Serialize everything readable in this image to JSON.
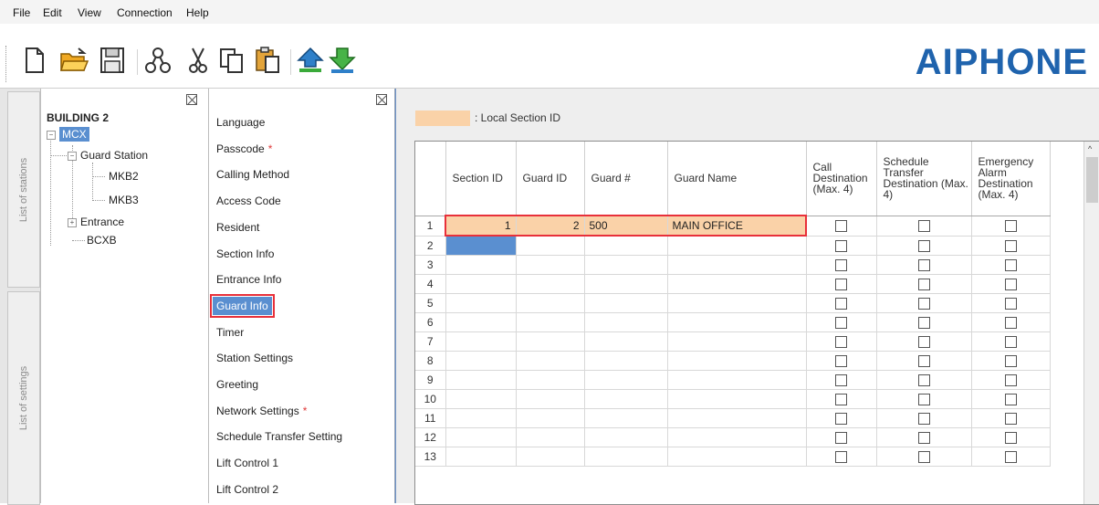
{
  "menu": [
    "File",
    "Edit",
    "View",
    "Connection",
    "Help"
  ],
  "brand": "AIPHONE",
  "side_tabs": {
    "stations": "List of stations",
    "settings": "List of settings"
  },
  "tree": {
    "root": "BUILDING 2",
    "mcx": "MCX",
    "guard_station": "Guard Station",
    "mkb2": "MKB2",
    "mkb3": "MKB3",
    "entrance": "Entrance",
    "bcxb": "BCXB"
  },
  "settings": [
    {
      "label": "Language",
      "required": false
    },
    {
      "label": "Passcode",
      "required": true
    },
    {
      "label": "Calling Method",
      "required": false
    },
    {
      "label": "Access Code",
      "required": false
    },
    {
      "label": "Resident",
      "required": false
    },
    {
      "label": "Section Info",
      "required": false
    },
    {
      "label": "Entrance Info",
      "required": false
    },
    {
      "label": "Guard Info",
      "required": false,
      "selected": true
    },
    {
      "label": "Timer",
      "required": false
    },
    {
      "label": "Station Settings",
      "required": false
    },
    {
      "label": "Greeting",
      "required": false
    },
    {
      "label": "Network Settings",
      "required": true
    },
    {
      "label": "Schedule Transfer Setting",
      "required": false
    },
    {
      "label": "Lift Control 1",
      "required": false
    },
    {
      "label": "Lift Control 2",
      "required": false
    }
  ],
  "legend": {
    "text": ": Local Section ID",
    "color": "#fad2a8"
  },
  "columns": [
    "Section ID",
    "Guard ID",
    "Guard #",
    "Guard Name",
    "Call Destination (Max. 4)",
    "Schedule Transfer Destination (Max. 4)",
    "Emergency Alarm Destination (Max. 4)"
  ],
  "rows": [
    {
      "n": "1",
      "section_id": "1",
      "guard_id": "2",
      "guard_num": "500",
      "guard_name": "MAIN OFFICE"
    },
    {
      "n": "2",
      "section_id": "",
      "guard_id": "",
      "guard_num": "",
      "guard_name": ""
    },
    {
      "n": "3",
      "section_id": "",
      "guard_id": "",
      "guard_num": "",
      "guard_name": ""
    },
    {
      "n": "4",
      "section_id": "",
      "guard_id": "",
      "guard_num": "",
      "guard_name": ""
    },
    {
      "n": "5",
      "section_id": "",
      "guard_id": "",
      "guard_num": "",
      "guard_name": ""
    },
    {
      "n": "6",
      "section_id": "",
      "guard_id": "",
      "guard_num": "",
      "guard_name": ""
    },
    {
      "n": "7",
      "section_id": "",
      "guard_id": "",
      "guard_num": "",
      "guard_name": ""
    },
    {
      "n": "8",
      "section_id": "",
      "guard_id": "",
      "guard_num": "",
      "guard_name": ""
    },
    {
      "n": "9",
      "section_id": "",
      "guard_id": "",
      "guard_num": "",
      "guard_name": ""
    },
    {
      "n": "10",
      "section_id": "",
      "guard_id": "",
      "guard_num": "",
      "guard_name": ""
    },
    {
      "n": "11",
      "section_id": "",
      "guard_id": "",
      "guard_num": "",
      "guard_name": ""
    },
    {
      "n": "12",
      "section_id": "",
      "guard_id": "",
      "guard_num": "",
      "guard_name": ""
    },
    {
      "n": "13",
      "section_id": "",
      "guard_id": "",
      "guard_num": "",
      "guard_name": ""
    }
  ],
  "colors": {
    "accent": "#1f63ad",
    "highlight": "#e8303a",
    "selection": "#5a8fd0",
    "row_fill": "#fad2a8"
  },
  "icons": [
    "new-file-icon",
    "open-folder-icon",
    "save-icon",
    "connection-icon",
    "cut-icon",
    "copy-icon",
    "paste-icon",
    "upload-icon",
    "download-icon"
  ]
}
